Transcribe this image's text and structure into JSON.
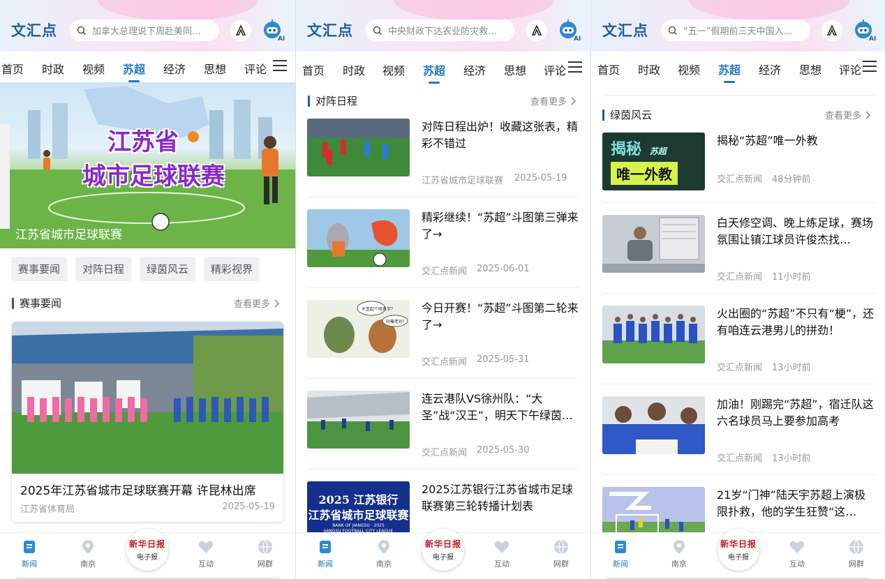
{
  "app": {
    "logo": "文汇点"
  },
  "panels": [
    {
      "search_placeholder": "加拿大总理说下周赴美同…",
      "tabs": [
        "首页",
        "时政",
        "视频",
        "苏超",
        "经济",
        "思想",
        "评论"
      ],
      "active_tab": 3,
      "hero": {
        "title_line1": "江苏省",
        "title_line2": "城市足球联赛",
        "caption": "江苏省城市足球联赛"
      },
      "chips": [
        "赛事要闻",
        "对阵日程",
        "绿茵风云",
        "精彩视界"
      ],
      "section": {
        "title": "赛事要闻",
        "more": "查看更多"
      },
      "card": {
        "title": "2025年江苏省城市足球联赛开幕 许昆林出席",
        "source": "江苏省体育局",
        "date": "2025-05-19"
      }
    },
    {
      "search_placeholder": "中央财政下达农业防灾救…",
      "tabs": [
        "首页",
        "时政",
        "视频",
        "苏超",
        "经济",
        "思想",
        "评论"
      ],
      "active_tab": 3,
      "section": {
        "title": "对阵日程",
        "more": "查看更多"
      },
      "items": [
        {
          "title": "对阵日程出炉！收藏这张表，精彩不错过",
          "source": "江苏省城市足球联赛",
          "time": "2025-05-19"
        },
        {
          "title": "精彩继续！“苏超”斗图第三弹来了→",
          "source": "交汇点新闻",
          "time": "2025-06-01"
        },
        {
          "title": "今日开赛！“苏超”斗图第二轮来了→",
          "source": "交汇点新闻",
          "time": "2025-05-31",
          "bubble1": "大圣起个啥名字？",
          "bubble2": "叫俺老孙！"
        },
        {
          "title": "连云港队VS徐州队：“大圣”战“汉王”，明天下午绿茵场上…",
          "source": "交汇点新闻",
          "time": "2025-05-30"
        },
        {
          "title": "2025江苏银行江苏省城市足球联赛第三轮转播计划表",
          "thumb_line1": "2025 江苏银行",
          "thumb_line2": "江苏省城市足球联赛",
          "thumb_line3": "BANK OF JIANGSU · 2025",
          "thumb_line4": "JIANGSU FOOTBALL CITY LEAGUE"
        }
      ]
    },
    {
      "search_placeholder": "“五一”假期前三天中国入…",
      "tabs": [
        "首页",
        "时政",
        "视频",
        "苏超",
        "经济",
        "思想",
        "评论"
      ],
      "active_tab": 3,
      "section": {
        "title": "绿茵风云",
        "more": "查看更多"
      },
      "items": [
        {
          "title": "揭秘“苏超”唯一外教",
          "source": "交汇点新闻",
          "time": "48分钟前",
          "thumb_line1": "揭秘",
          "thumb_tag": "苏超",
          "thumb_line2": "唯一外教"
        },
        {
          "title": "白天修空调、晚上练足球，赛场氛围让镇江球员许俊杰找…",
          "source": "交汇点新闻",
          "time": "11小时前"
        },
        {
          "title": "火出圈的“苏超”不只有“梗”，还有咱连云港男儿的拼劲！",
          "source": "交汇点新闻",
          "time": "13小时前"
        },
        {
          "title": "加油！刚踢完“苏超”，宿迁队这六名球员马上要参加高考",
          "source": "交汇点新闻",
          "time": "13小时前"
        },
        {
          "title": "21岁“门神”陆天宇苏超上演极限扑救，他的学生狂赞“这…"
        }
      ]
    }
  ],
  "bottom_nav": {
    "items": [
      "新闻",
      "南京",
      "互动",
      "网群"
    ],
    "center_logo": "新华日报",
    "center_label": "电子报",
    "active": 0
  },
  "colors": {
    "accent": "#1f78c1",
    "brand": "#1b5fa8",
    "red": "#c8161d"
  }
}
